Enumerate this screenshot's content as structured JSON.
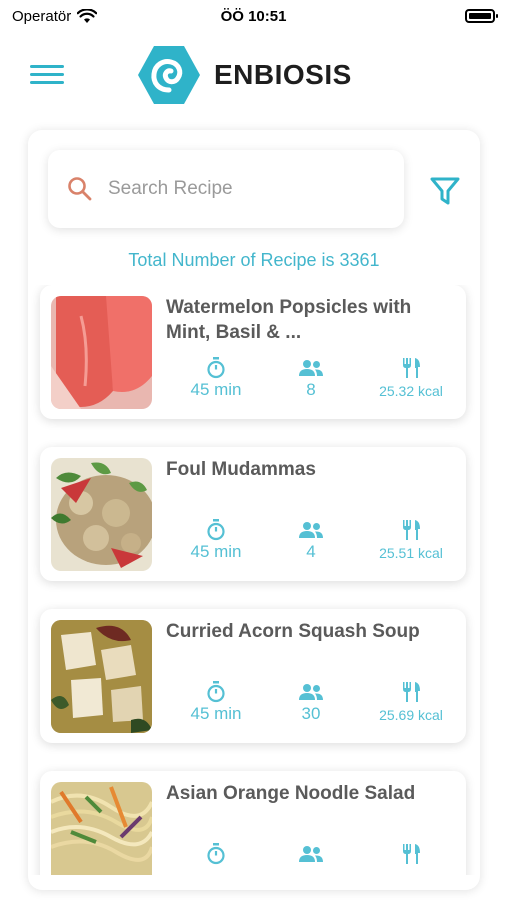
{
  "status_bar": {
    "carrier": "Operatör",
    "time": "ÖÖ 10:51"
  },
  "header": {
    "brand": "ENBIOSIS"
  },
  "search": {
    "placeholder": "Search Recipe"
  },
  "total_text": "Total Number of Recipe is 3361",
  "colors": {
    "accent": "#2fb3c9",
    "text_dark": "#5a5a5a",
    "stat": "#55c0d4"
  },
  "recipes": [
    {
      "title": "Watermelon Popsicles with Mint, Basil & ...",
      "time": "45 min",
      "servings": "8",
      "calories": "25.32 kcal"
    },
    {
      "title": "Foul Mudammas",
      "time": "45 min",
      "servings": "4",
      "calories": "25.51 kcal"
    },
    {
      "title": "Curried Acorn Squash Soup",
      "time": "45 min",
      "servings": "30",
      "calories": "25.69 kcal"
    },
    {
      "title": "Asian Orange Noodle Salad",
      "time": "",
      "servings": "",
      "calories": ""
    }
  ],
  "icons": [
    "wifi-icon",
    "battery-icon",
    "menu-icon",
    "logo-icon",
    "search-icon",
    "filter-icon",
    "timer-icon",
    "people-icon",
    "utensils-icon"
  ]
}
